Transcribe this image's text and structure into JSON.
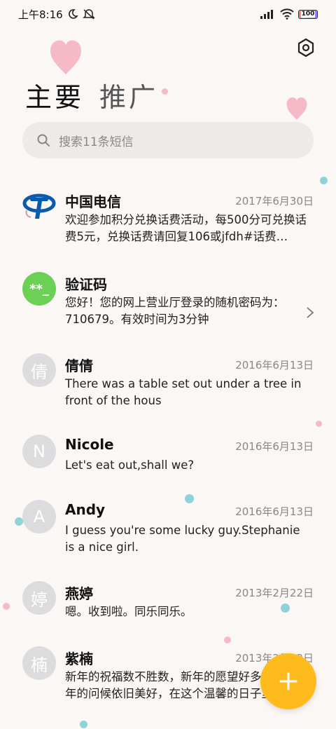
{
  "status_bar": {
    "time": "上午8:16",
    "battery": "100"
  },
  "tabs": [
    {
      "label": "主要"
    },
    {
      "label": "推广"
    }
  ],
  "search": {
    "placeholder": "搜索11条短信"
  },
  "messages": [
    {
      "name": "中国电信",
      "date": "2017年6月30日",
      "preview": "欢迎参加积分兑换话费活动，每500分可兑换话费5元，兑换话费请回复106或jfdh#话费…",
      "avatar": "china-telecom-logo"
    },
    {
      "name": "验证码",
      "date": "",
      "preview": "您好！您的网上营业厅登录的随机密码为：710679。有效时间为3分钟",
      "avatar": "**_"
    },
    {
      "name": "倩倩",
      "date": "2016年6月13日",
      "preview": "There was a table set out under a tree in front of the hous",
      "avatar": "倩"
    },
    {
      "name": "Nicole",
      "date": "2016年6月13日",
      "preview": "Let's eat out,shall we?",
      "avatar": "N"
    },
    {
      "name": "Andy",
      "date": "2016年6月13日",
      "preview": "I guess you're some lucky guy.Stephanie is a nice girl.",
      "avatar": "A"
    },
    {
      "name": "燕婷",
      "date": "2013年2月22日",
      "preview": "嗯。收到啦。同乐同乐。",
      "avatar": "婷"
    },
    {
      "name": "紫楠",
      "date": "2013年2月22日",
      "preview": "新年的祝福数不胜数，新年的愿望好多好多，新年的问候依旧美好，在这个温馨的日子里",
      "avatar": "楠"
    }
  ],
  "colors": {
    "accent_fab": "#fdbb1e",
    "verification_avatar": "#6bd055",
    "telecom_blue": "#0a5bab"
  }
}
